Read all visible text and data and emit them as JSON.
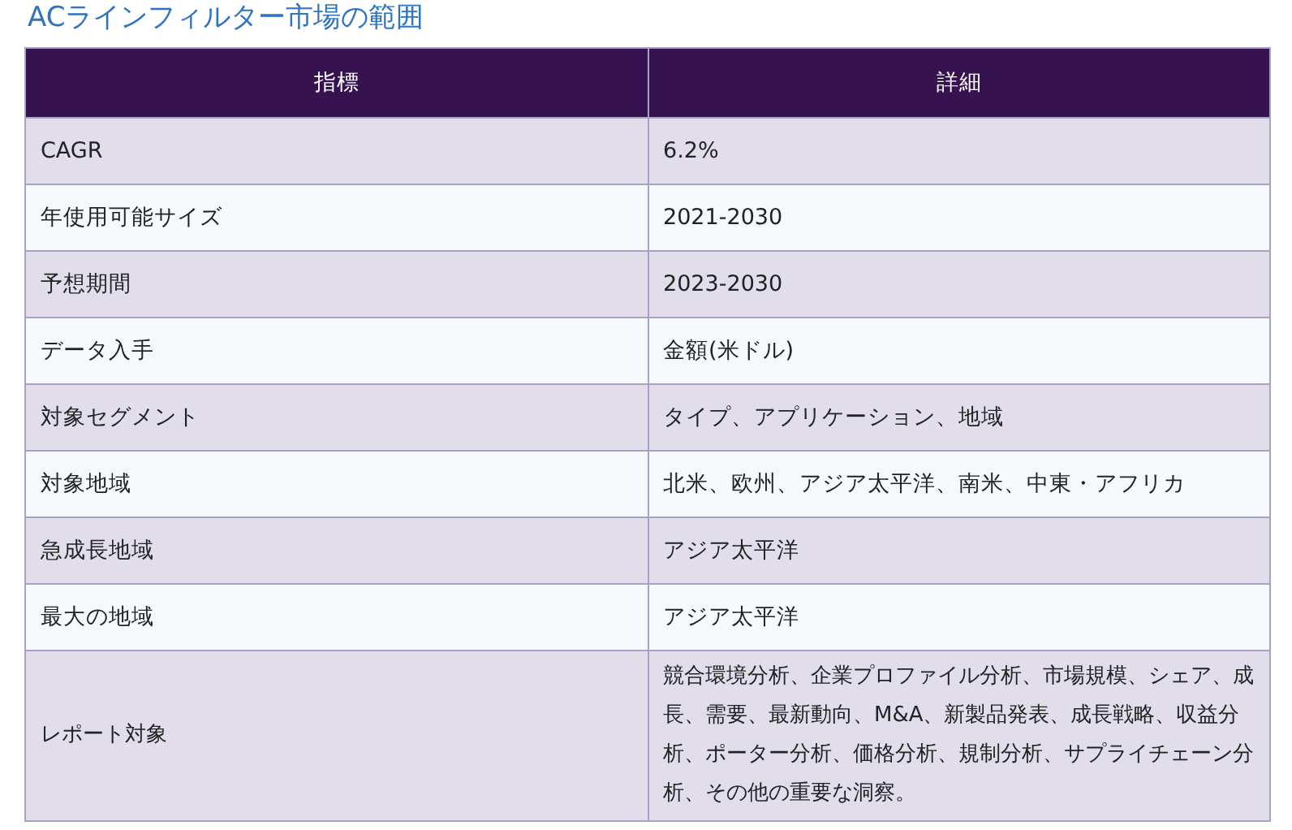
{
  "title": "ACラインフィルター市場の範囲",
  "table": {
    "columns": [
      "指標",
      "詳細"
    ],
    "rows": [
      [
        "CAGR",
        "6.2%"
      ],
      [
        "年使用可能サイズ",
        "2021-2030"
      ],
      [
        "予想期間",
        "2023-2030"
      ],
      [
        "データ入手",
        "金額(米ドル)"
      ],
      [
        "対象セグメント",
        "タイプ、アプリケーション、地域"
      ],
      [
        "対象地域",
        "北米、欧州、アジア太平洋、南米、中東・アフリカ"
      ],
      [
        "急成長地域",
        "アジア太平洋"
      ],
      [
        "最大の地域",
        "アジア太平洋"
      ],
      [
        "レポート対象",
        "競合環境分析、企業プロファイル分析、市場規模、シェア、成長、需要、最新動向、M&A、新製品発表、成長戦略、収益分析、ポーター分析、価格分析、規制分析、サプライチェーン分析、その他の重要な洞察。"
      ]
    ]
  }
}
